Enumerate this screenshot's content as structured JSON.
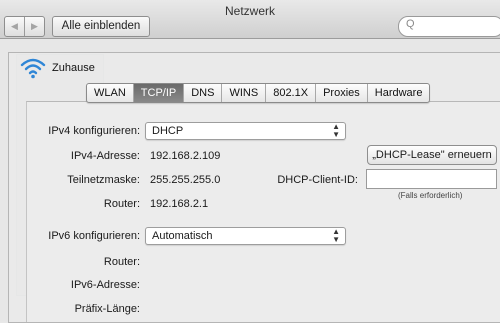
{
  "window": {
    "title": "Netzwerk"
  },
  "toolbar": {
    "back_glyph": "◀",
    "forward_glyph": "▶",
    "show_all_label": "Alle einblenden",
    "search_placeholder": "Q"
  },
  "sheet": {
    "network_name": "Zuhause",
    "wifi_icon": "wifi-icon"
  },
  "tabs": [
    {
      "label": "WLAN",
      "selected": false
    },
    {
      "label": "TCP/IP",
      "selected": true
    },
    {
      "label": "DNS",
      "selected": false
    },
    {
      "label": "WINS",
      "selected": false
    },
    {
      "label": "802.1X",
      "selected": false
    },
    {
      "label": "Proxies",
      "selected": false
    },
    {
      "label": "Hardware",
      "selected": false
    }
  ],
  "tcpip": {
    "ipv4_configure_label": "IPv4 konfigurieren:",
    "ipv4_configure_value": "DHCP",
    "ipv4_address_label": "IPv4-Adresse:",
    "ipv4_address_value": "192.168.2.109",
    "renew_lease_label": "„DHCP-Lease\" erneuern",
    "subnet_mask_label": "Teilnetzmaske:",
    "subnet_mask_value": "255.255.255.0",
    "dhcp_client_id_label": "DHCP-Client-ID:",
    "dhcp_client_id_value": "",
    "dhcp_client_id_hint": "(Falls erforderlich)",
    "router_label": "Router:",
    "router_value": "192.168.2.1",
    "ipv6_configure_label": "IPv6 konfigurieren:",
    "ipv6_configure_value": "Automatisch",
    "ipv6_router_label": "Router:",
    "ipv6_address_label": "IPv6-Adresse:",
    "prefix_length_label": "Präfix-Länge:"
  },
  "colors": {
    "selected_tab": "#7a7a7a",
    "wifi_blue": "#2f86d6"
  }
}
